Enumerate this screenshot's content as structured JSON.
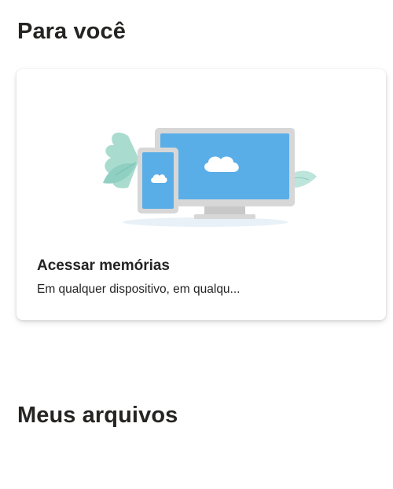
{
  "sections": {
    "for_you_title": "Para você",
    "my_files_title": "Meus arquivos"
  },
  "card": {
    "title": "Acessar memórias",
    "subtitle": "Em qualquer dispositivo, em qualqu...",
    "illustration_icon": "devices-cloud-illustration"
  },
  "colors": {
    "screen_blue": "#5aaee8",
    "device_gray": "#d6d6d6",
    "leaf_teal": "#a8d8cf"
  }
}
